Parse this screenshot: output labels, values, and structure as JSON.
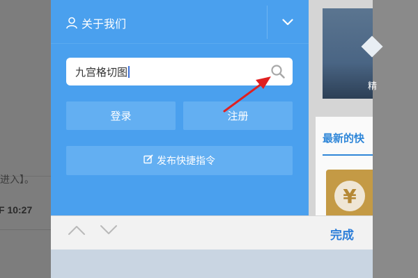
{
  "background": {
    "left_text": "进入】。",
    "left_time": "F 10:27"
  },
  "menu": {
    "about_label": "关于我们",
    "search_value": "九宫格切图",
    "login_label": "登录",
    "register_label": "注册",
    "publish_label": "发布快捷指令"
  },
  "right": {
    "thumb_char": "精",
    "latest_title": "最新的快",
    "coin_symbol": "¥"
  },
  "keyboard": {
    "done_label": "完成"
  },
  "colors": {
    "menu_bg": "#4aa0ee",
    "accent": "#2e86d8",
    "annotation_arrow": "#e02020"
  }
}
